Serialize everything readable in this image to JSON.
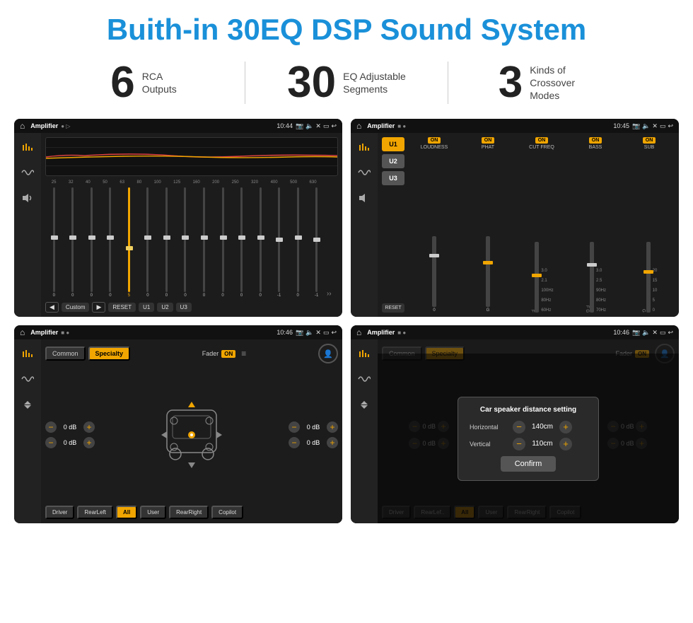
{
  "header": {
    "title": "Buith-in 30EQ DSP Sound System"
  },
  "stats": [
    {
      "number": "6",
      "label_line1": "RCA",
      "label_line2": "Outputs"
    },
    {
      "number": "30",
      "label_line1": "EQ Adjustable",
      "label_line2": "Segments"
    },
    {
      "number": "3",
      "label_line1": "Kinds of",
      "label_line2": "Crossover Modes"
    }
  ],
  "screens": {
    "eq": {
      "title": "Amplifier",
      "time": "10:44",
      "freqs": [
        "25",
        "32",
        "40",
        "50",
        "63",
        "80",
        "100",
        "125",
        "160",
        "200",
        "250",
        "320",
        "400",
        "500",
        "630"
      ],
      "values": [
        "0",
        "0",
        "0",
        "0",
        "5",
        "0",
        "0",
        "0",
        "0",
        "0",
        "0",
        "0",
        "-1",
        "0",
        "-1"
      ],
      "buttons": [
        "Custom",
        "RESET",
        "U1",
        "U2",
        "U3"
      ]
    },
    "crossover": {
      "title": "Amplifier",
      "time": "10:45",
      "u_buttons": [
        "U1",
        "U2",
        "U3"
      ],
      "channels": [
        {
          "label": "LOUDNESS",
          "on": true
        },
        {
          "label": "PHAT",
          "on": true
        },
        {
          "label": "CUT FREQ",
          "on": true
        },
        {
          "label": "BASS",
          "on": true
        },
        {
          "label": "SUB",
          "on": true
        }
      ]
    },
    "fader": {
      "title": "Amplifier",
      "time": "10:46",
      "tabs": [
        "Common",
        "Specialty"
      ],
      "active_tab": "Specialty",
      "fader_label": "Fader",
      "fader_on": "ON",
      "db_values": [
        "0 dB",
        "0 dB",
        "0 dB",
        "0 dB"
      ],
      "bottom_buttons": [
        "Driver",
        "RearLeft",
        "All",
        "User",
        "RearRight",
        "Copilot"
      ]
    },
    "dialog": {
      "title": "Amplifier",
      "time": "10:46",
      "dialog_title": "Car speaker distance setting",
      "horizontal_label": "Horizontal",
      "horizontal_value": "140cm",
      "vertical_label": "Vertical",
      "vertical_value": "110cm",
      "confirm_label": "Confirm",
      "bottom_buttons": [
        "Driver",
        "RearLef..",
        "All",
        "User",
        "RearRight",
        "Copilot"
      ],
      "db_values": [
        "0 dB",
        "0 dB"
      ]
    }
  }
}
